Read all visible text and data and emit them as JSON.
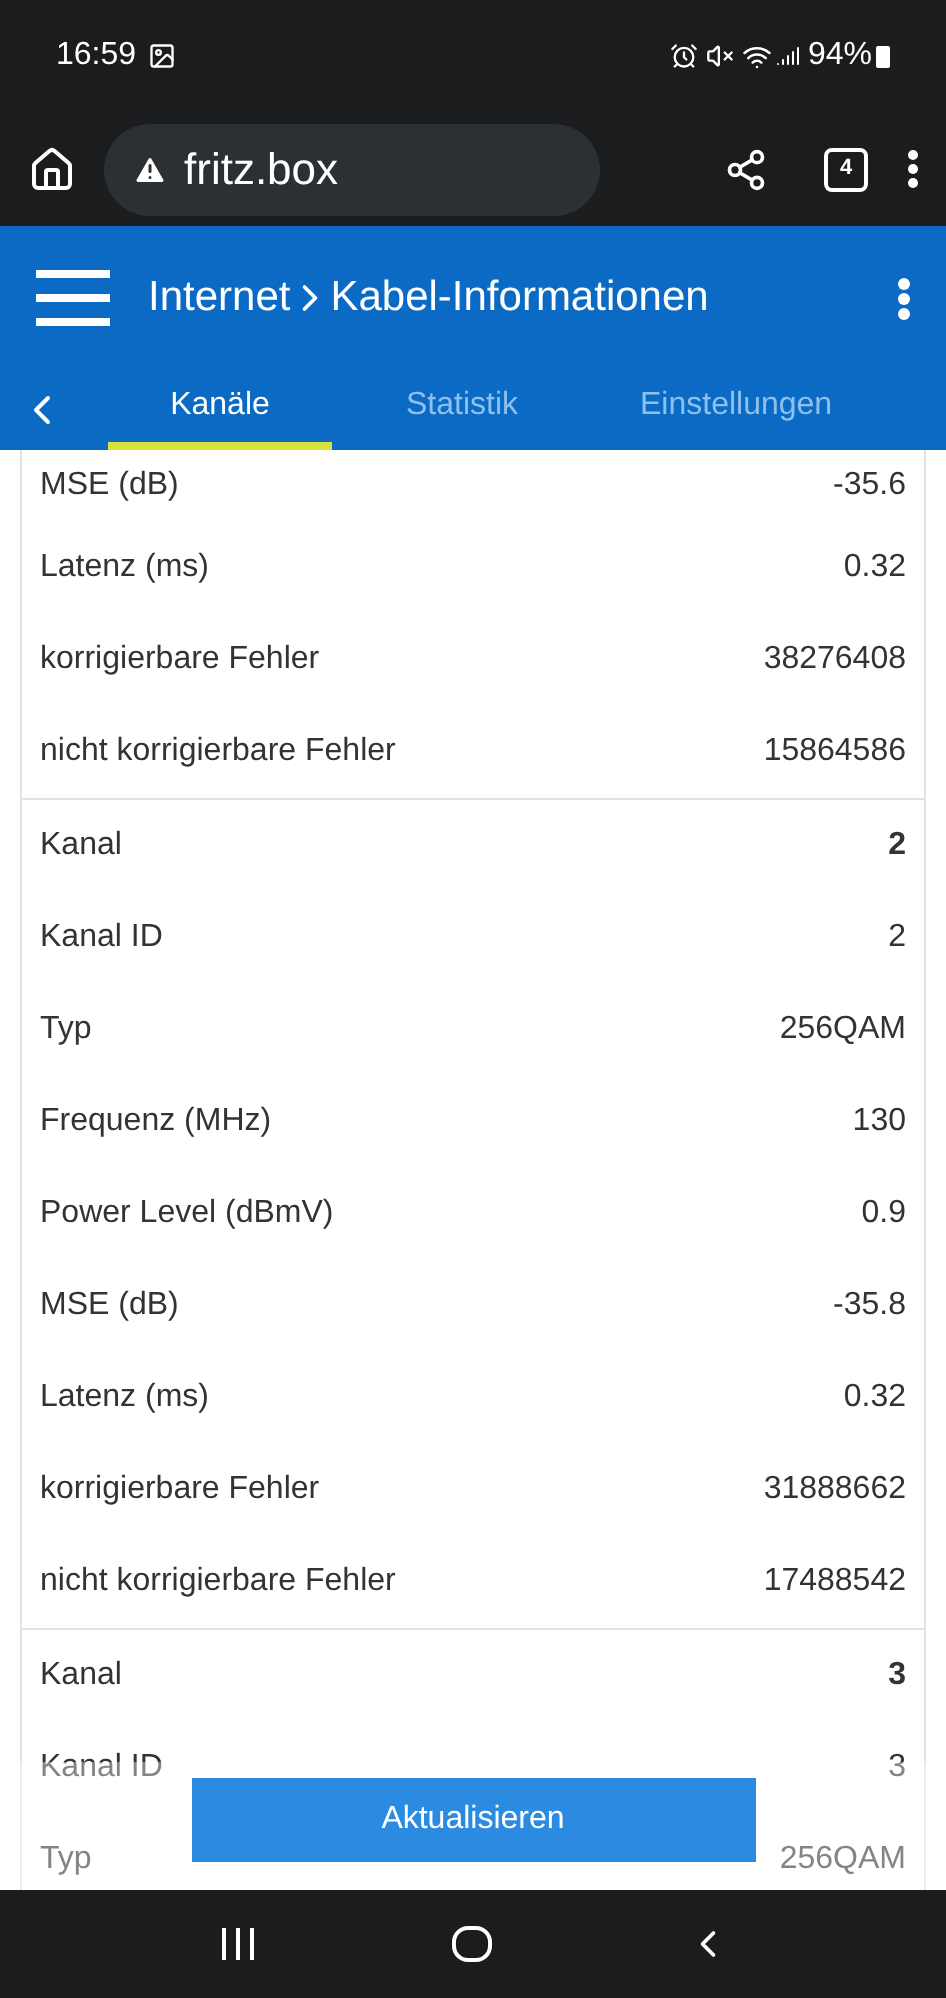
{
  "status_bar": {
    "time": "16:59",
    "battery": "94%"
  },
  "browser": {
    "url": "fritz.box",
    "tab_count": "4"
  },
  "header": {
    "title": "Internet",
    "subtitle": "Kabel-Informationen"
  },
  "tabs": [
    {
      "label": "Kanäle",
      "selected": true
    },
    {
      "label": "Statistik",
      "selected": false
    },
    {
      "label": "Einstellungen",
      "selected": false
    }
  ],
  "groups": [
    {
      "rows": [
        {
          "label": "MSE (dB)",
          "value": "-35.6",
          "kind": "plain"
        },
        {
          "label": "Latenz (ms)",
          "value": "0.32",
          "kind": "plain"
        },
        {
          "label": "korrigierbare Fehler",
          "value": "38276408",
          "kind": "plain"
        },
        {
          "label": "nicht korrigierbare Fehler",
          "value": "15864586",
          "kind": "plain"
        }
      ]
    },
    {
      "rows": [
        {
          "label": "Kanal",
          "value": "2",
          "kind": "channel"
        },
        {
          "label": "Kanal ID",
          "value": "2",
          "kind": "plain"
        },
        {
          "label": "Typ",
          "value": "256QAM",
          "kind": "plain"
        },
        {
          "label": "Frequenz (MHz)",
          "value": "130",
          "kind": "plain"
        },
        {
          "label": "Power Level (dBmV)",
          "value": "0.9",
          "kind": "plain"
        },
        {
          "label": "MSE (dB)",
          "value": "-35.8",
          "kind": "plain"
        },
        {
          "label": "Latenz (ms)",
          "value": "0.32",
          "kind": "plain"
        },
        {
          "label": "korrigierbare Fehler",
          "value": "31888662",
          "kind": "plain"
        },
        {
          "label": "nicht korrigierbare Fehler",
          "value": "17488542",
          "kind": "plain"
        }
      ]
    },
    {
      "rows": [
        {
          "label": "Kanal",
          "value": "3",
          "kind": "channel"
        },
        {
          "label": "Kanal ID",
          "value": "3",
          "kind": "plain"
        },
        {
          "label": "Typ",
          "value": "256QAM",
          "kind": "plain"
        }
      ]
    }
  ],
  "refresh_button": "Aktualisieren"
}
